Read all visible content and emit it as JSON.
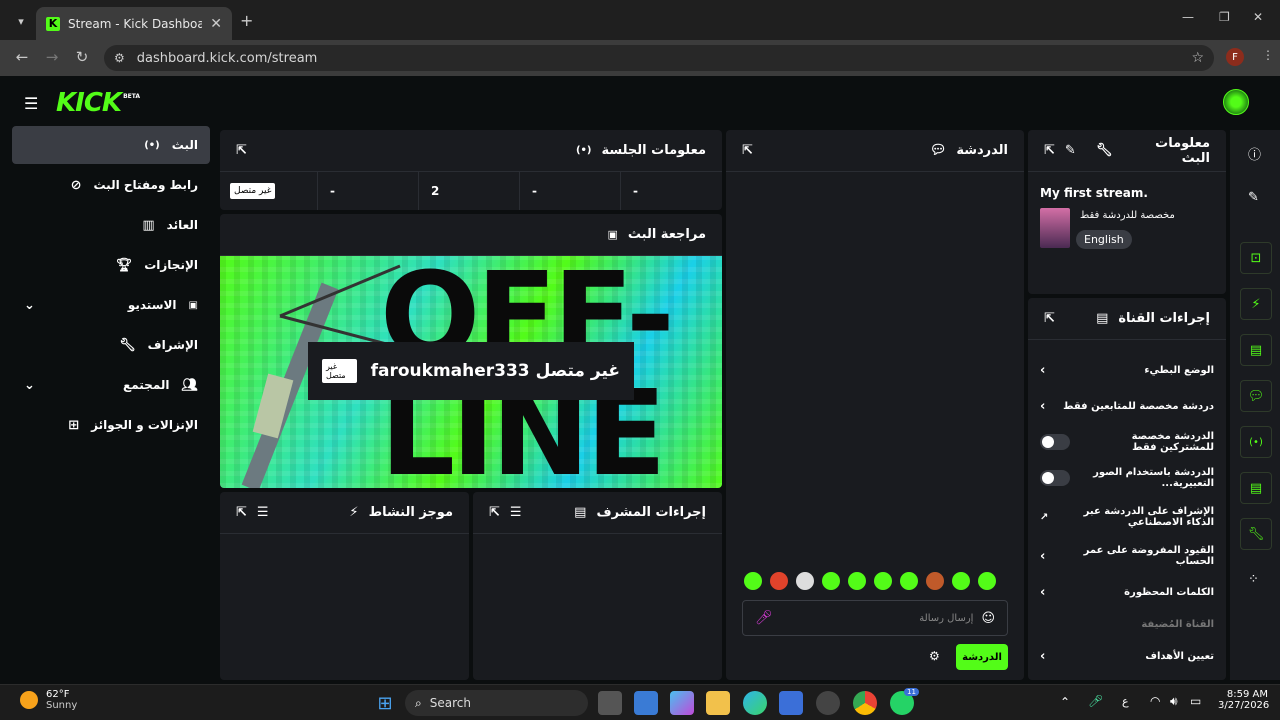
{
  "browser": {
    "tab_title": "Stream - Kick Dashboard",
    "url": "dashboard.kick.com/stream",
    "profile_initial": "F"
  },
  "app": {
    "logo": "KICK",
    "logo_badge": "BETA"
  },
  "sidebar": {
    "items": [
      {
        "label": "البث",
        "icon": "broadcast-icon"
      },
      {
        "label": "رابط ومفتاح البث",
        "icon": "link-icon"
      },
      {
        "label": "العائد",
        "icon": "chart-icon"
      },
      {
        "label": "الإنجازات",
        "icon": "trophy-icon"
      },
      {
        "label": "الاستديو",
        "icon": "studio-icon"
      },
      {
        "label": "الإشراف",
        "icon": "wrench-icon"
      },
      {
        "label": "المجتمع",
        "icon": "community-icon"
      },
      {
        "label": "الإنزالات و الجوائز",
        "icon": "drops-icon"
      }
    ]
  },
  "session": {
    "title": "معلومات الجلسة",
    "status_badge": "غير متصل",
    "stats": [
      "-",
      "2",
      "-",
      "-"
    ]
  },
  "preview": {
    "title": "مراجعة البث",
    "badge": "غير متصل",
    "channel_status": "faroukmaher333 غير متصل",
    "offline_text": "OFF-LINE"
  },
  "activity": {
    "title": "موجز النشاط"
  },
  "mod_actions": {
    "title": "إجراءات المشرف"
  },
  "chat": {
    "title": "الدردشة",
    "placeholder": "إرسال رسالة",
    "send_label": "الدردشة"
  },
  "stream_info": {
    "title": "معلومات البث",
    "stream_title": "My first stream.",
    "category": "مخصصة للدردشة فقط",
    "language": "English"
  },
  "channel_actions": {
    "title": "إجراءات القناة",
    "rows": [
      {
        "label": "الوضع البطيء",
        "control": "chevron"
      },
      {
        "label": "دردشة مخصصة للمتابعين فقط",
        "control": "chevron"
      },
      {
        "label": "الدردشة مخصصة للمشتركين فقط",
        "control": "toggle"
      },
      {
        "label": "الدردشة باستخدام الصور التعبيرية...",
        "control": "toggle"
      },
      {
        "label": "الإشراف على الدردشة عبر الذكاء الاصطناعي",
        "control": "external"
      },
      {
        "label": "القيود المفروضة على عمر الحساب",
        "control": "chevron"
      },
      {
        "label": "الكلمات المحظورة",
        "control": "chevron"
      }
    ],
    "hosted_label": "القناة المُضيفة",
    "goals_label": "تعيين الأهداف"
  },
  "taskbar": {
    "weather_temp": "62°F",
    "weather_desc": "Sunny",
    "search_label": "Search",
    "time": "8:59 AM",
    "date": "3/27/2026",
    "lang": "ع",
    "whatsapp_badge": "11"
  },
  "colors": {
    "accent": "#53fc18",
    "panel": "#191b1f",
    "bg": "#0b0e0f"
  }
}
